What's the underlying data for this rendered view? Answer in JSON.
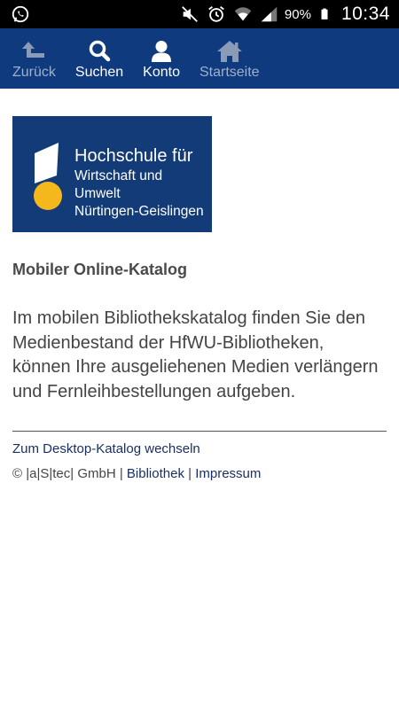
{
  "status_bar": {
    "battery_percent": "90%",
    "time": "10:34"
  },
  "navbar": {
    "items": [
      {
        "label": "Zurück",
        "icon": "back-arrow-icon"
      },
      {
        "label": "Suchen",
        "icon": "search-icon"
      },
      {
        "label": "Konto",
        "icon": "user-icon"
      },
      {
        "label": "Startseite",
        "icon": "home-icon"
      }
    ]
  },
  "logo": {
    "line1": "Hochschule für",
    "line2": "Wirtschaft und Umwelt",
    "line3": "Nürtingen-Geislingen"
  },
  "main": {
    "title": "Mobiler Online-Katalog",
    "intro": "Im mobilen Bibliothekskatalog finden Sie den Medienbestand der HfWU-Bibliotheken, können Ihre ausgeliehenen Medien verlängern und Fernleihbestellungen aufgeben."
  },
  "footer": {
    "desktop_link": "Zum Desktop-Katalog wechseln",
    "copyright": "© |a|S|tec| GmbH",
    "separator": "|",
    "library_link": "Bibliothek",
    "imprint_link": "Impressum"
  },
  "colors": {
    "navbar_bg": "#103a7e",
    "logo_bg": "#123b77",
    "logo_accent": "#f5b81c",
    "link": "#1a2f66"
  }
}
